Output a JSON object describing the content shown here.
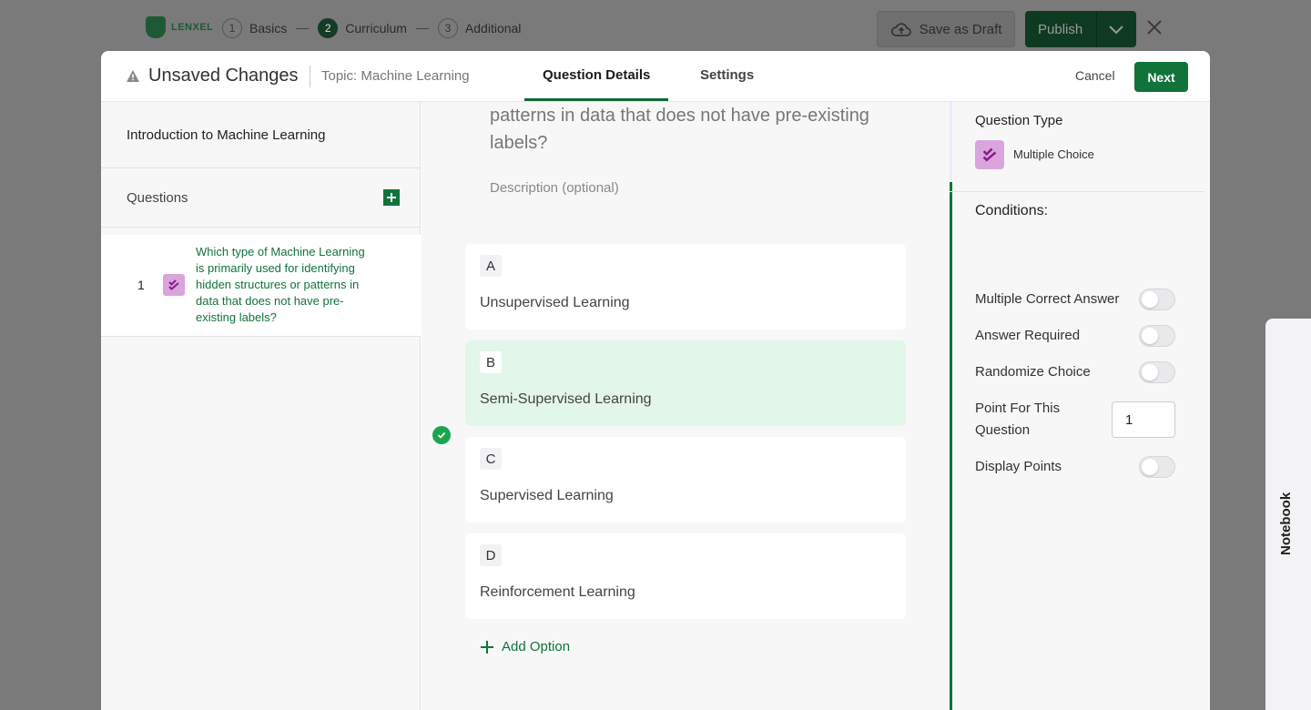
{
  "background": {
    "logo_text": "LENXEL",
    "steps": [
      {
        "num": "1",
        "label": "Basics"
      },
      {
        "num": "2",
        "label": "Curriculum"
      },
      {
        "num": "3",
        "label": "Additional"
      }
    ],
    "save_draft": "Save as Draft",
    "publish": "Publish"
  },
  "notebook_tab": "Notebook",
  "modal": {
    "title": "Unsaved Changes",
    "topic": "Topic: Machine Learning",
    "tabs": [
      {
        "label": "Question Details",
        "active": true
      },
      {
        "label": "Settings",
        "active": false
      }
    ],
    "cancel": "Cancel",
    "next": "Next"
  },
  "left_panel": {
    "lesson_title": "Introduction to Machine Learning",
    "questions_heading": "Questions",
    "questions": [
      {
        "number": "1",
        "text": "Which type of Machine Learning is primarily used for identifying hidden structures or patterns in data that does not have pre-existing labels?"
      }
    ]
  },
  "editor": {
    "question_text_visible": "patterns in data that does not have pre-existing labels?",
    "description_placeholder": "Description (optional)",
    "options": [
      {
        "letter": "A",
        "text": "Unsupervised Learning",
        "correct": false
      },
      {
        "letter": "B",
        "text": "Semi-Supervised Learning",
        "correct": true
      },
      {
        "letter": "C",
        "text": "Supervised Learning",
        "correct": false
      },
      {
        "letter": "D",
        "text": "Reinforcement Learning",
        "correct": false
      }
    ],
    "add_option": "Add Option"
  },
  "settings_panel": {
    "question_type_label": "Question Type",
    "question_type_value": "Multiple Choice",
    "conditions_title": "Conditions:",
    "multiple_correct_answer": {
      "label": "Multiple Correct Answer",
      "on": false
    },
    "answer_required": {
      "label": "Answer Required",
      "on": false
    },
    "randomize_choice": {
      "label": "Randomize Choice",
      "on": false
    },
    "points_label": "Point For This Question",
    "points_value": "1",
    "display_points": {
      "label": "Display Points",
      "on": false
    }
  },
  "colors": {
    "brand_green": "#12733a",
    "correct_bg": "#e2f6ea",
    "question_type_icon": "#d9a5dc"
  }
}
